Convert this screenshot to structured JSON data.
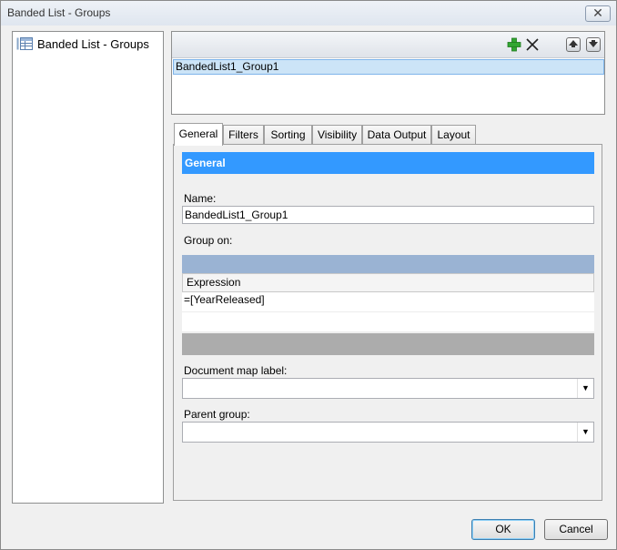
{
  "window": {
    "title": "Banded List - Groups",
    "close_glyph": "✕"
  },
  "tree": {
    "item_label": "Banded List - Groups",
    "item_icon": "banded-list-icon"
  },
  "groups": {
    "toolbar": {
      "add_icon": "plus-icon",
      "delete_icon": "close-icon",
      "up_icon": "move-up-icon",
      "down_icon": "move-down-icon"
    },
    "selected_item": "BandedList1_Group1"
  },
  "tabs": [
    "General",
    "Filters",
    "Sorting",
    "Visibility",
    "Data Output",
    "Layout"
  ],
  "general": {
    "section_title": "General",
    "name_label": "Name:",
    "name_value": "BandedList1_Group1",
    "group_on_label": "Group on:",
    "expression_header": "Expression",
    "expressions": [
      "=[YearReleased]",
      ""
    ],
    "doc_map_label": "Document map label:",
    "doc_map_value": "",
    "parent_group_label": "Parent group:",
    "parent_group_value": ""
  },
  "buttons": {
    "ok": "OK",
    "cancel": "Cancel"
  },
  "colors": {
    "section_header": "#3399ff",
    "selection": "#cce4f7",
    "grid_top": "#9ab3d3",
    "grid_bottom": "#acacac"
  }
}
